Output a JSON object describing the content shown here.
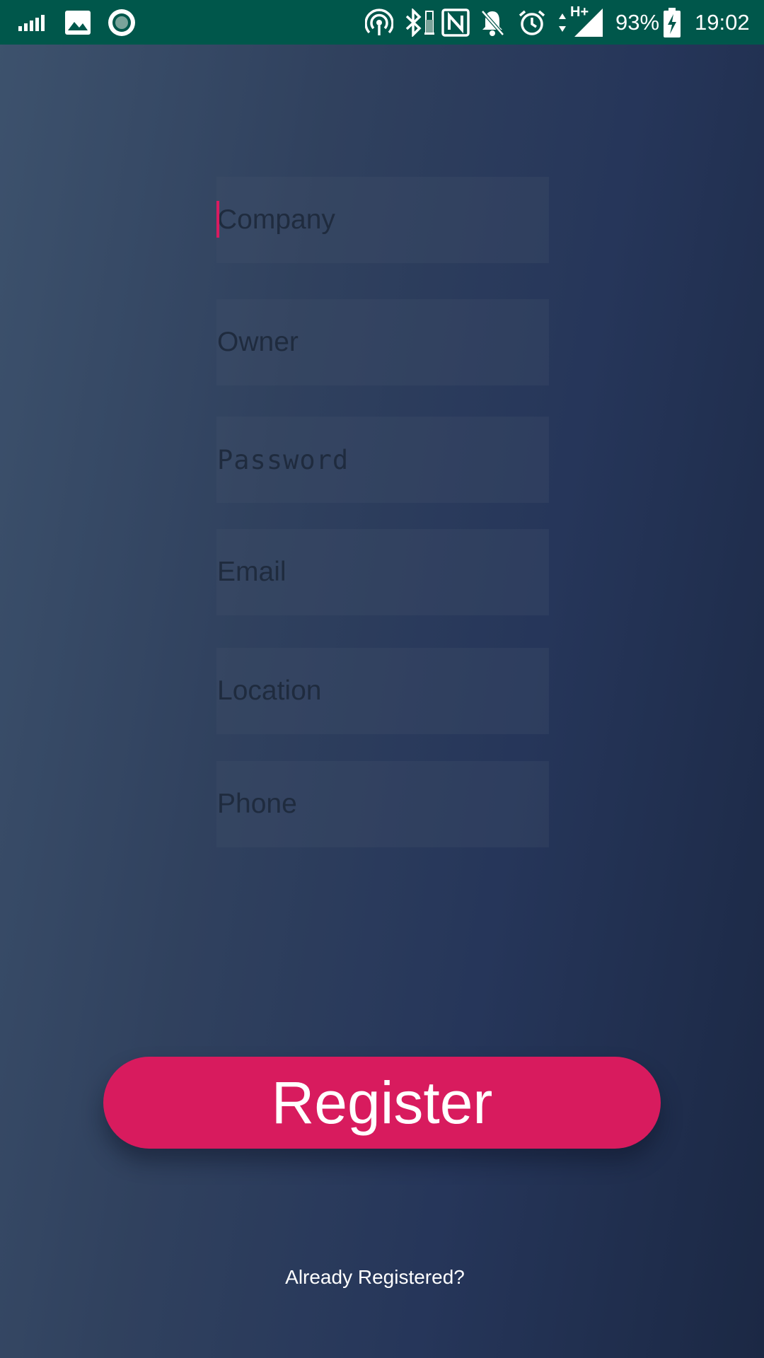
{
  "status_bar": {
    "battery": "93%",
    "time": "19:02",
    "network_type": "H+",
    "icons": [
      "signal-bars-icon",
      "image-icon",
      "record-icon",
      "hotspot-icon",
      "bluetooth-icon",
      "battery-small-icon",
      "nfc-icon",
      "bell-off-icon",
      "alarm-icon",
      "data-arrows-icon",
      "cell-signal-icon",
      "battery-charging-icon"
    ],
    "colors": {
      "background": "#00574b"
    }
  },
  "form": {
    "company_placeholder": "Company",
    "owner_placeholder": "Owner",
    "password_placeholder": "Password",
    "email_placeholder": "Email",
    "location_placeholder": "Location",
    "phone_placeholder": "Phone"
  },
  "actions": {
    "register_label": "Register",
    "already_registered_label": "Already Registered?"
  },
  "colors": {
    "accent": "#d81b5e",
    "background_start": "#3d526d",
    "background_end": "#1b2844"
  }
}
